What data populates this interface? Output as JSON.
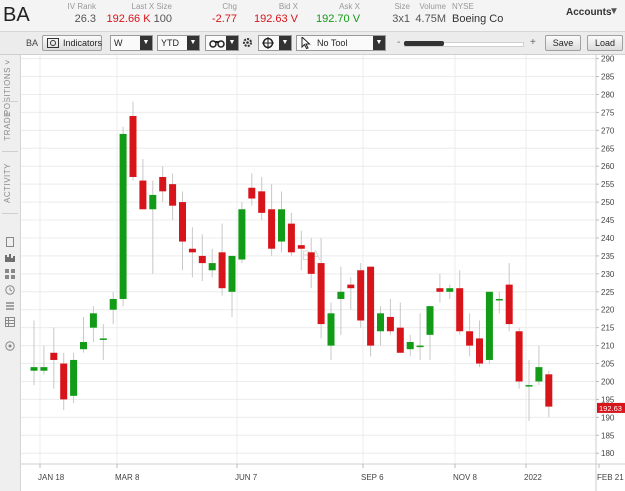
{
  "header": {
    "symbol": "BA",
    "stats": [
      {
        "label": "IV Rank",
        "value": "26.3",
        "color": "#555555"
      },
      {
        "label": "Last X Size",
        "value": "192.66 K 100",
        "color": "#555555"
      },
      {
        "label": "Chg",
        "value": "-2.77",
        "color": "#d8141b"
      },
      {
        "label": "Bid X",
        "value": "192.63 V",
        "color": "#d8141b"
      },
      {
        "label": "Ask X",
        "value": "192.70 V",
        "color": "#119b17"
      },
      {
        "label": "Size",
        "value": "3x1",
        "color": "#555555"
      },
      {
        "label": "Volume",
        "value": "4.75M",
        "color": "#555555"
      }
    ],
    "exchange": "NYSE",
    "company": "Boeing Co",
    "accounts": "Accounts"
  },
  "toolbar": {
    "symbol": "BA",
    "indicators": "Indicators",
    "interval": "W",
    "range": "YTD",
    "tool": "No Tool",
    "zoom_minus": "-",
    "zoom_plus": "+",
    "save": "Save",
    "load": "Load"
  },
  "sidebar": {
    "tabs": [
      "POSITIONS",
      "TRADE",
      "ACTIVITY"
    ]
  },
  "chart_data": {
    "type": "candlestick",
    "watermark": "BA",
    "current_price_label": "192.63",
    "x_tick_labels": [
      "JAN 18",
      "MAR 8",
      "JUN 7",
      "SEP 6",
      "NOV 8",
      "2022",
      "FEB 21"
    ],
    "y_ticks": [
      180,
      185,
      190,
      195,
      200,
      205,
      210,
      215,
      220,
      225,
      230,
      235,
      240,
      245,
      250,
      255,
      260,
      265,
      270,
      275,
      280,
      285,
      290
    ],
    "ylim": [
      177,
      291
    ],
    "up_color": "#119b17",
    "down_color": "#d8141b",
    "candles": [
      {
        "o": 203,
        "h": 217,
        "l": 199,
        "c": 204
      },
      {
        "o": 203,
        "h": 210,
        "l": 202,
        "c": 204
      },
      {
        "o": 208,
        "h": 215,
        "l": 198,
        "c": 206
      },
      {
        "o": 205,
        "h": 208,
        "l": 192,
        "c": 195
      },
      {
        "o": 196,
        "h": 208,
        "l": 194,
        "c": 206
      },
      {
        "o": 209,
        "h": 218,
        "l": 208,
        "c": 211
      },
      {
        "o": 215,
        "h": 221,
        "l": 211,
        "c": 219
      },
      {
        "o": 212,
        "h": 216,
        "l": 206,
        "c": 212
      },
      {
        "o": 220,
        "h": 225,
        "l": 216,
        "c": 223
      },
      {
        "o": 223,
        "h": 271,
        "l": 221,
        "c": 269
      },
      {
        "o": 274,
        "h": 278,
        "l": 256,
        "c": 257
      },
      {
        "o": 256,
        "h": 262,
        "l": 249,
        "c": 248
      },
      {
        "o": 248,
        "h": 256,
        "l": 230,
        "c": 252
      },
      {
        "o": 257,
        "h": 260,
        "l": 250,
        "c": 253
      },
      {
        "o": 255,
        "h": 258,
        "l": 245,
        "c": 249
      },
      {
        "o": 250,
        "h": 253,
        "l": 231,
        "c": 239
      },
      {
        "o": 237,
        "h": 243,
        "l": 229,
        "c": 236
      },
      {
        "o": 235,
        "h": 241,
        "l": 228,
        "c": 233
      },
      {
        "o": 231,
        "h": 237,
        "l": 229,
        "c": 233
      },
      {
        "o": 236,
        "h": 244,
        "l": 224,
        "c": 226
      },
      {
        "o": 225,
        "h": 235,
        "l": 218,
        "c": 235
      },
      {
        "o": 234,
        "h": 250,
        "l": 233,
        "c": 248
      },
      {
        "o": 254,
        "h": 258,
        "l": 249,
        "c": 251
      },
      {
        "o": 253,
        "h": 257,
        "l": 245,
        "c": 247
      },
      {
        "o": 248,
        "h": 255,
        "l": 235,
        "c": 237
      },
      {
        "o": 239,
        "h": 253,
        "l": 236,
        "c": 248
      },
      {
        "o": 244,
        "h": 247,
        "l": 235,
        "c": 236
      },
      {
        "o": 238,
        "h": 242,
        "l": 231,
        "c": 237
      },
      {
        "o": 236,
        "h": 240,
        "l": 226,
        "c": 230
      },
      {
        "o": 233,
        "h": 240,
        "l": 212,
        "c": 216
      },
      {
        "o": 210,
        "h": 222,
        "l": 206,
        "c": 219
      },
      {
        "o": 223,
        "h": 232,
        "l": 213,
        "c": 225
      },
      {
        "o": 227,
        "h": 229,
        "l": 220,
        "c": 226
      },
      {
        "o": 231,
        "h": 233,
        "l": 215,
        "c": 217
      },
      {
        "o": 232,
        "h": 232,
        "l": 207,
        "c": 210
      },
      {
        "o": 214,
        "h": 221,
        "l": 210,
        "c": 219
      },
      {
        "o": 218,
        "h": 223,
        "l": 213,
        "c": 214
      },
      {
        "o": 215,
        "h": 222,
        "l": 208,
        "c": 208
      },
      {
        "o": 209,
        "h": 213,
        "l": 207,
        "c": 211
      },
      {
        "o": 210,
        "h": 219,
        "l": 206,
        "c": 210
      },
      {
        "o": 213,
        "h": 221,
        "l": 206,
        "c": 221
      },
      {
        "o": 226,
        "h": 230,
        "l": 222,
        "c": 225
      },
      {
        "o": 225,
        "h": 227,
        "l": 223,
        "c": 226
      },
      {
        "o": 226,
        "h": 231,
        "l": 213,
        "c": 214
      },
      {
        "o": 214,
        "h": 219,
        "l": 207,
        "c": 210
      },
      {
        "o": 212,
        "h": 217,
        "l": 204,
        "c": 205
      },
      {
        "o": 206,
        "h": 225,
        "l": 205,
        "c": 225
      },
      {
        "o": 223,
        "h": 225,
        "l": 219,
        "c": 223
      },
      {
        "o": 227,
        "h": 233,
        "l": 214,
        "c": 216
      },
      {
        "o": 214,
        "h": 215,
        "l": 198,
        "c": 200
      },
      {
        "o": 199,
        "h": 206,
        "l": 189,
        "c": 199
      },
      {
        "o": 200,
        "h": 210,
        "l": 199,
        "c": 204
      },
      {
        "o": 202,
        "h": 203,
        "l": 190,
        "c": 193
      }
    ]
  }
}
